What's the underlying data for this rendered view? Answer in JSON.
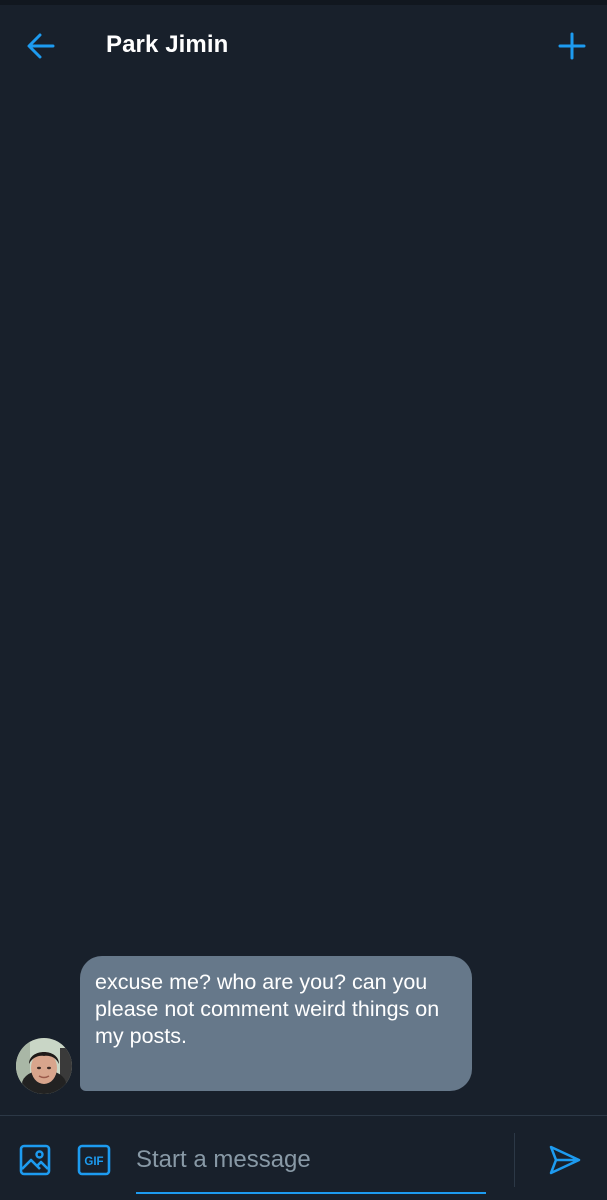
{
  "header": {
    "title": "Park Jimin",
    "back_icon": "arrow-left-icon",
    "add_icon": "plus-icon"
  },
  "conversation": {
    "messages": [
      {
        "sender": "other",
        "text": "excuse me? who are you? can you please not comment weird things on my posts."
      }
    ]
  },
  "composer": {
    "placeholder": "Start a message",
    "value": "",
    "image_icon": "image-icon",
    "gif_label": "GIF",
    "send_icon": "send-icon"
  },
  "colors": {
    "background": "#18202b",
    "accent": "#1d9bf0",
    "bubble": "#66788a",
    "placeholder": "#8899a6"
  }
}
